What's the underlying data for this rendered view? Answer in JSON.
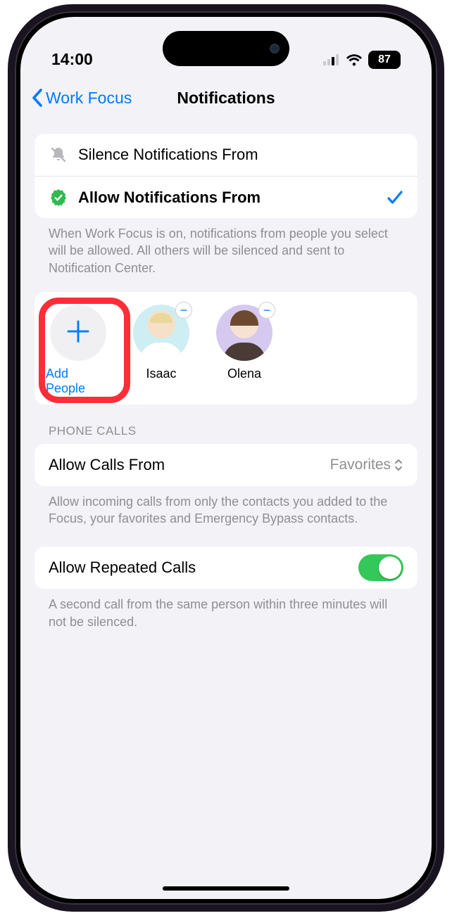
{
  "status": {
    "time": "14:00",
    "battery": "87"
  },
  "nav": {
    "back_label": "Work Focus",
    "title": "Notifications"
  },
  "modes": {
    "silence_label": "Silence Notifications From",
    "allow_label": "Allow Notifications From"
  },
  "modes_footer": "When Work Focus is on, notifications from people you select will be allowed. All others will be silenced and sent to Notification Center.",
  "people": {
    "add_label": "Add People",
    "list": [
      {
        "name": "Isaac"
      },
      {
        "name": "Olena"
      }
    ]
  },
  "phone_calls": {
    "header": "PHONE CALLS",
    "allow_from_label": "Allow Calls From",
    "allow_from_value": "Favorites",
    "allow_from_footer": "Allow incoming calls from only the contacts you added to the Focus, your favorites and Emergency Bypass contacts.",
    "repeated_label": "Allow Repeated Calls",
    "repeated_on": true,
    "repeated_footer": "A second call from the same person within three minutes will not be silenced."
  }
}
